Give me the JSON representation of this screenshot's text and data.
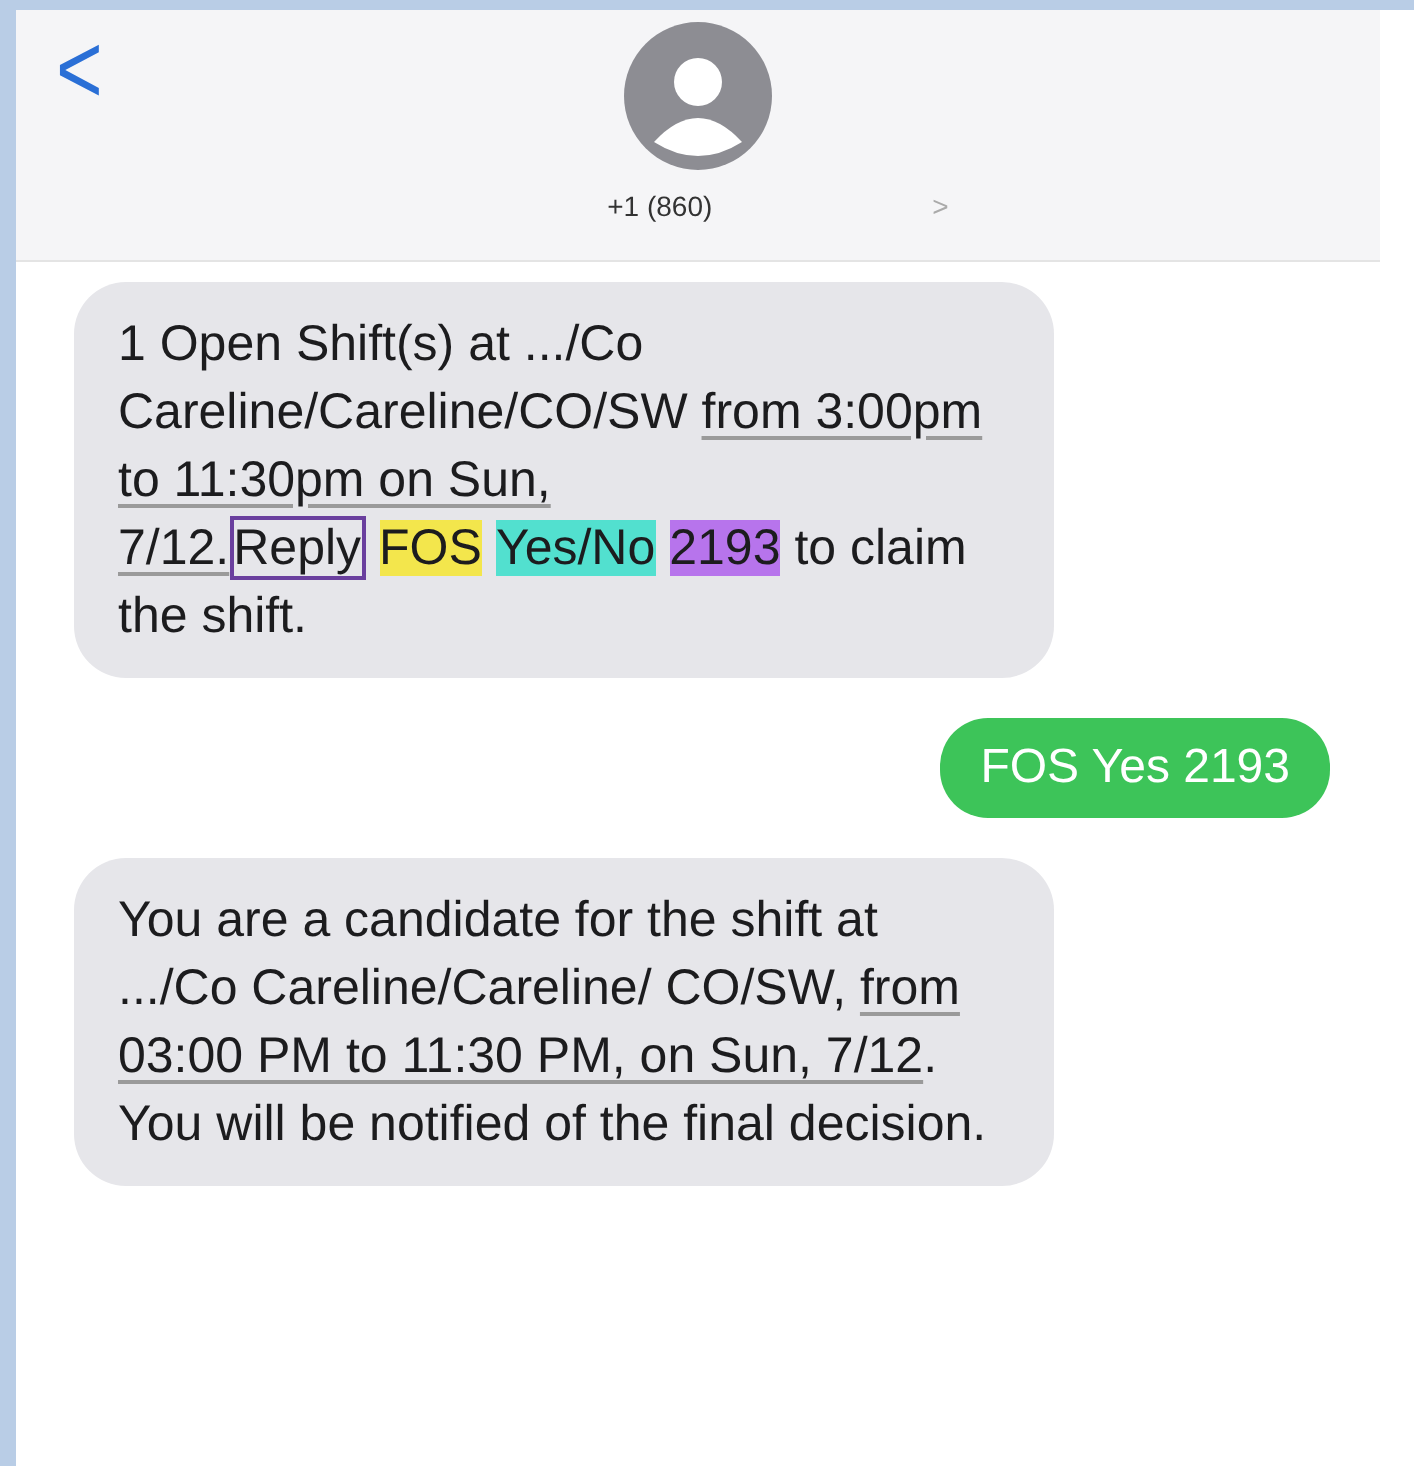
{
  "header": {
    "back": "<",
    "contact": "+1 (860)",
    "chevron": ">"
  },
  "messages": [
    {
      "kind": "received",
      "segments": [
        {
          "kind": "plain",
          "text": "1 Open Shift(s) at .../Co Careline/Careline/CO/SW "
        },
        {
          "kind": "link",
          "text": "from 3:00pm to 11:30pm on Sun, 7/12."
        },
        {
          "kind": "boxed",
          "text": "Reply",
          "color": "#6a3f9e"
        },
        {
          "kind": "highlight",
          "text": "FOS",
          "color": "#f3e64c"
        },
        {
          "kind": "highlight",
          "text": "Yes/No",
          "color": "#52e0cf"
        },
        {
          "kind": "highlight",
          "text": "2193",
          "color": "#b774ec"
        },
        {
          "kind": "plain",
          "text": " to claim the shift."
        }
      ]
    },
    {
      "kind": "sent",
      "segments": [
        {
          "kind": "plain",
          "text": "FOS Yes 2193"
        }
      ]
    },
    {
      "kind": "received",
      "segments": [
        {
          "kind": "plain",
          "text": "You are a candidate for the shift at .../Co Careline/Careline/ CO/SW, "
        },
        {
          "kind": "link",
          "text": "from 03:00 PM to 11:30 PM, on Sun, 7/12"
        },
        {
          "kind": "plain",
          "text": ". You will be notified of the final decision."
        }
      ]
    }
  ]
}
